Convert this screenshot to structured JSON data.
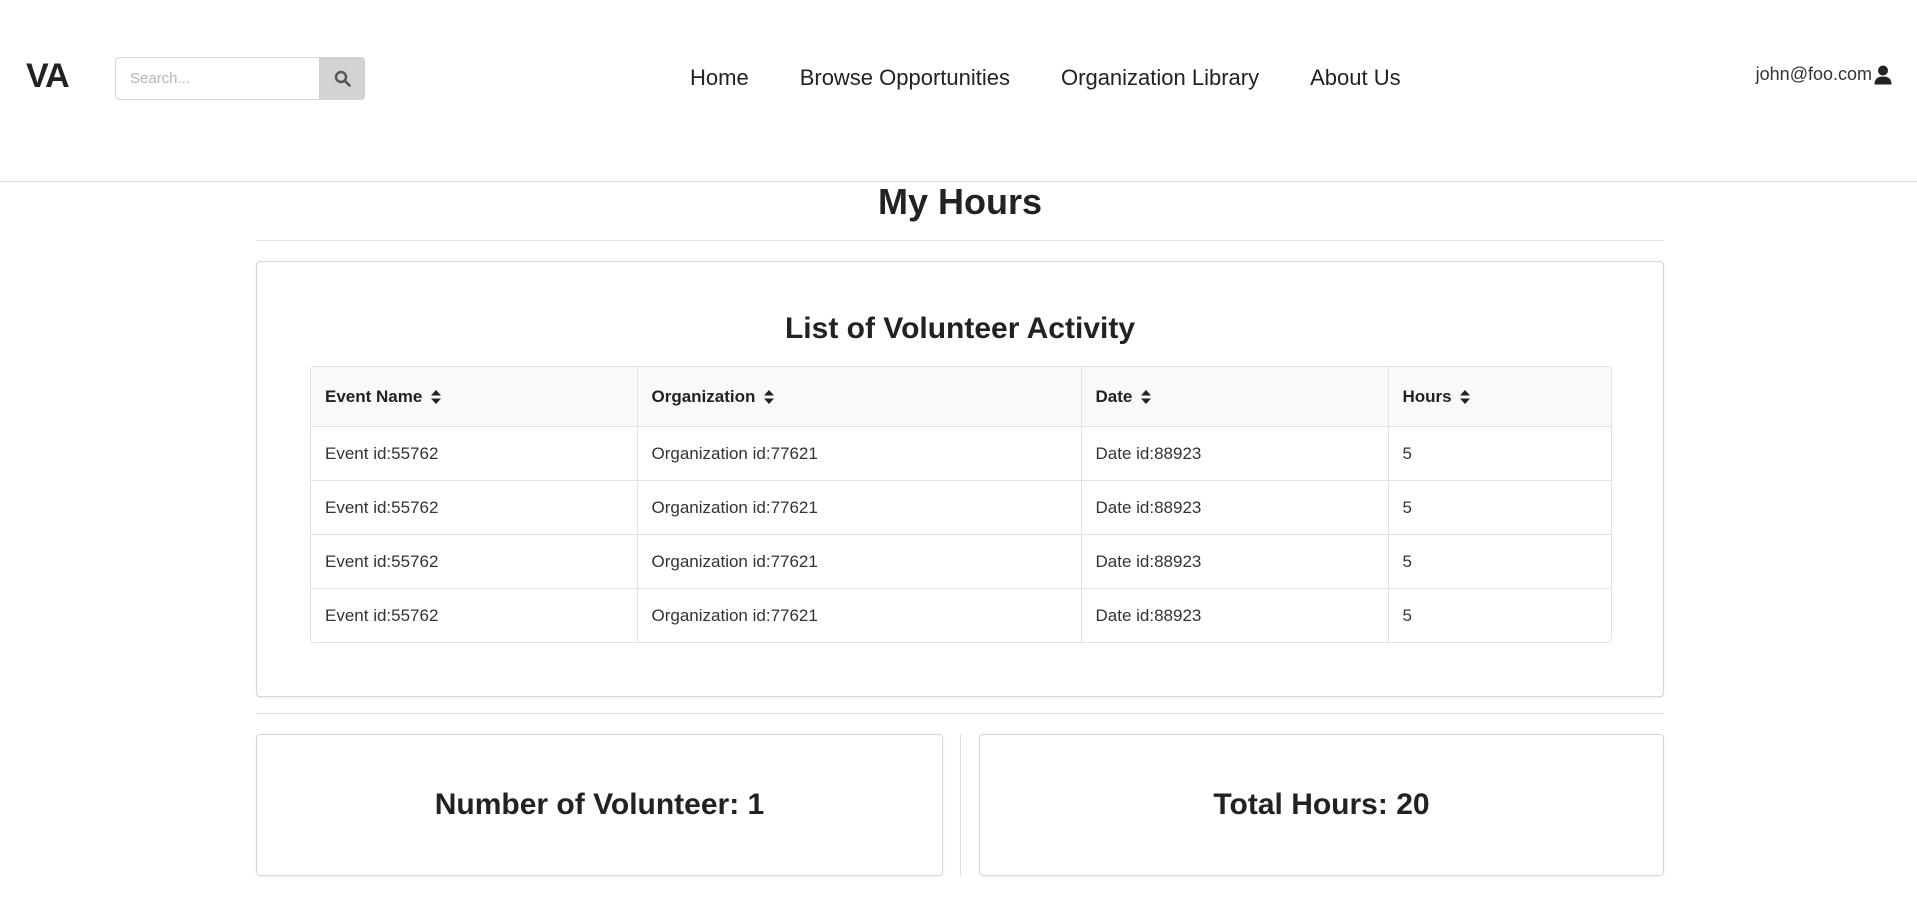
{
  "header": {
    "logo": "VA",
    "search": {
      "placeholder": "Search...",
      "value": ""
    },
    "nav": [
      "Home",
      "Browse Opportunities",
      "Organization Library",
      "About Us"
    ],
    "user_email": "john@foo.com"
  },
  "page": {
    "title": "My Hours"
  },
  "activity": {
    "title": "List of Volunteer Activity",
    "columns": [
      "Event Name",
      "Organization",
      "Date",
      "Hours"
    ],
    "rows": [
      [
        "Event id:55762",
        "Organization id:77621",
        "Date id:88923",
        "5"
      ],
      [
        "Event id:55762",
        "Organization id:77621",
        "Date id:88923",
        "5"
      ],
      [
        "Event id:55762",
        "Organization id:77621",
        "Date id:88923",
        "5"
      ],
      [
        "Event id:55762",
        "Organization id:77621",
        "Date id:88923",
        "5"
      ]
    ]
  },
  "stats": {
    "volunteers": "Number of Volunteer: 1",
    "total_hours": "Total Hours: 20"
  },
  "icons": {
    "search": "search-icon",
    "user": "user-icon",
    "sort": "sort-icon"
  }
}
